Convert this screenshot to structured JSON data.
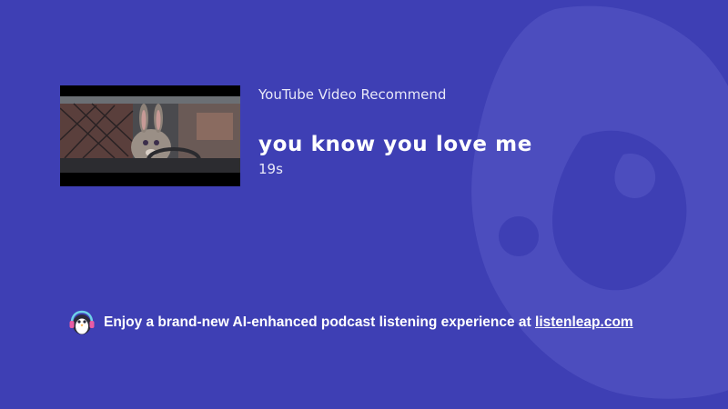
{
  "video": {
    "source_label": "YouTube Video Recommend",
    "title": "you know you love me",
    "duration": "19s"
  },
  "promo": {
    "text": "Enjoy a brand-new AI-enhanced podcast listening experience at",
    "link_text": "listenleap.com"
  },
  "colors": {
    "background": "#3e3fb4",
    "text": "#ffffff"
  },
  "icons": {
    "background": "listenleap-logo-watermark",
    "promo": "penguin-headphones-icon"
  }
}
